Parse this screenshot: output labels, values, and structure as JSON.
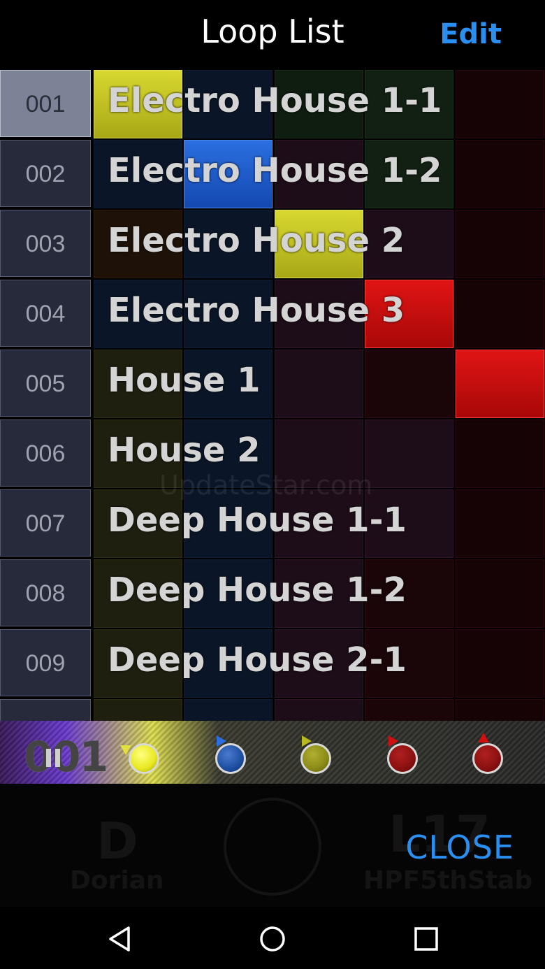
{
  "header": {
    "title": "Loop List",
    "edit_label": "Edit"
  },
  "rows": [
    {
      "number": "001",
      "name": "Electro House 1-1"
    },
    {
      "number": "002",
      "name": "Electro House 1-2"
    },
    {
      "number": "003",
      "name": "Electro House 2"
    },
    {
      "number": "004",
      "name": "Electro House 3"
    },
    {
      "number": "005",
      "name": "House 1"
    },
    {
      "number": "006",
      "name": "House 2"
    },
    {
      "number": "007",
      "name": "Deep House 1-1"
    },
    {
      "number": "008",
      "name": "Deep House 1-2"
    },
    {
      "number": "009",
      "name": "Deep House 2-1"
    }
  ],
  "player": {
    "loop_counter": "001"
  },
  "panel": {
    "close_label": "CLOSE"
  },
  "watermark": "UpdateStar.com",
  "colors": {
    "accent": "#2a8ff0",
    "yellow": "#d8d830",
    "blue": "#2b6fe0",
    "red": "#e01414"
  },
  "icons": {
    "play_state": "pause-icon",
    "nav": [
      "back-icon",
      "home-icon",
      "recents-icon"
    ]
  }
}
